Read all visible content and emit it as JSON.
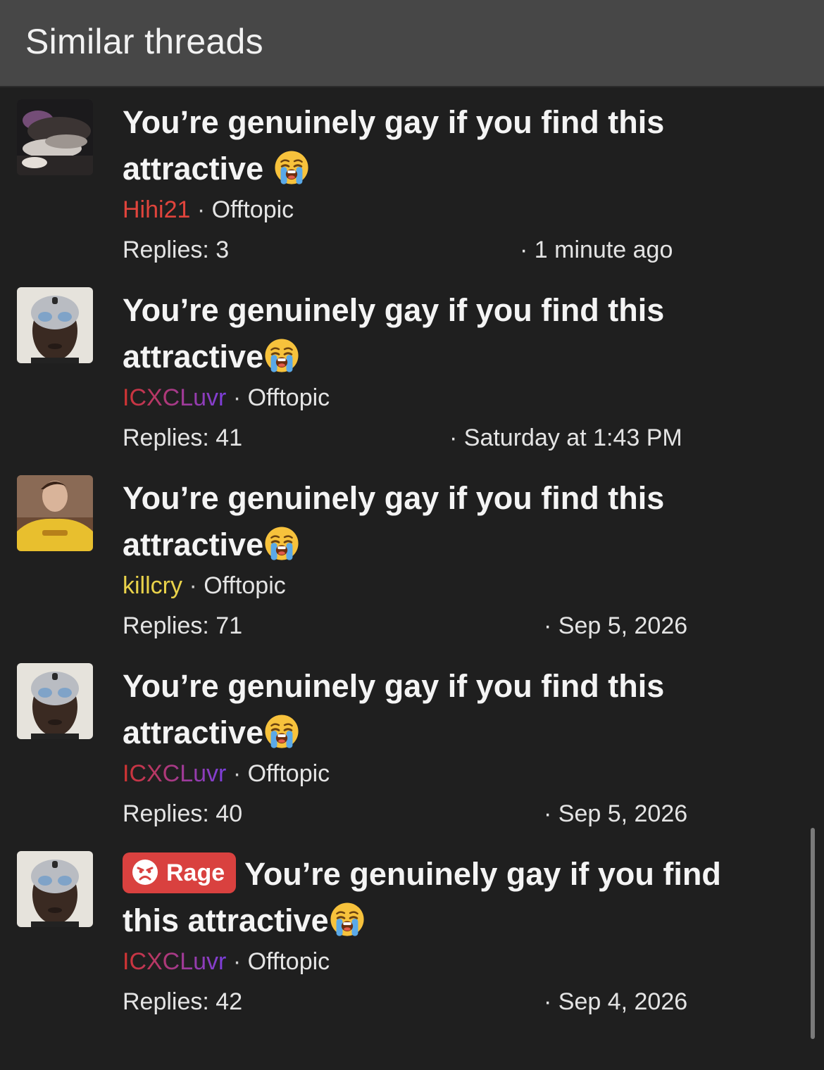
{
  "header": {
    "title": "Similar threads"
  },
  "threads": [
    {
      "title_line1": "You’re genuinely gay if you find this",
      "title_line2": "attractive",
      "emoji": "loudly-crying-face-icon",
      "username": "Hihi21",
      "username_color": "#e0443c",
      "separator": "·",
      "forum": "Offtopic",
      "replies": "Replies: 3",
      "time": "· 1 minute ago"
    },
    {
      "title_line1": "You’re genuinely gay if you find this",
      "title_line2": "attractive",
      "emoji": "loudly-crying-face-icon",
      "username": "ICXCLuvr",
      "username_color": "gradient-red-purple",
      "separator": "·",
      "forum": "Offtopic",
      "replies": "Replies: 41",
      "time": "· Saturday at 1:43 PM"
    },
    {
      "title_line1": "You’re genuinely gay if you find this",
      "title_line2": "attractive",
      "emoji": "loudly-crying-face-icon",
      "username": "killcry",
      "username_color": "#e9d24a",
      "separator": "·",
      "forum": "Offtopic",
      "replies": "Replies: 71",
      "time": "· Sep 5, 2026"
    },
    {
      "title_line1": "You’re genuinely gay if you find this",
      "title_line2": "attractive",
      "emoji": "loudly-crying-face-icon",
      "username": "ICXCLuvr",
      "username_color": "gradient-red-purple",
      "separator": "·",
      "forum": "Offtopic",
      "replies": "Replies: 40",
      "time": "· Sep 5, 2026"
    },
    {
      "prefix_badge": "Rage",
      "prefix_color": "#d9413f",
      "title_line1": "You’re genuinely gay if you find",
      "title_line2": "this attractive",
      "emoji": "loudly-crying-face-icon",
      "username": "ICXCLuvr",
      "username_color": "gradient-red-purple",
      "separator": "·",
      "forum": "Offtopic",
      "replies": "Replies: 42",
      "time": "· Sep 4, 2026"
    }
  ]
}
